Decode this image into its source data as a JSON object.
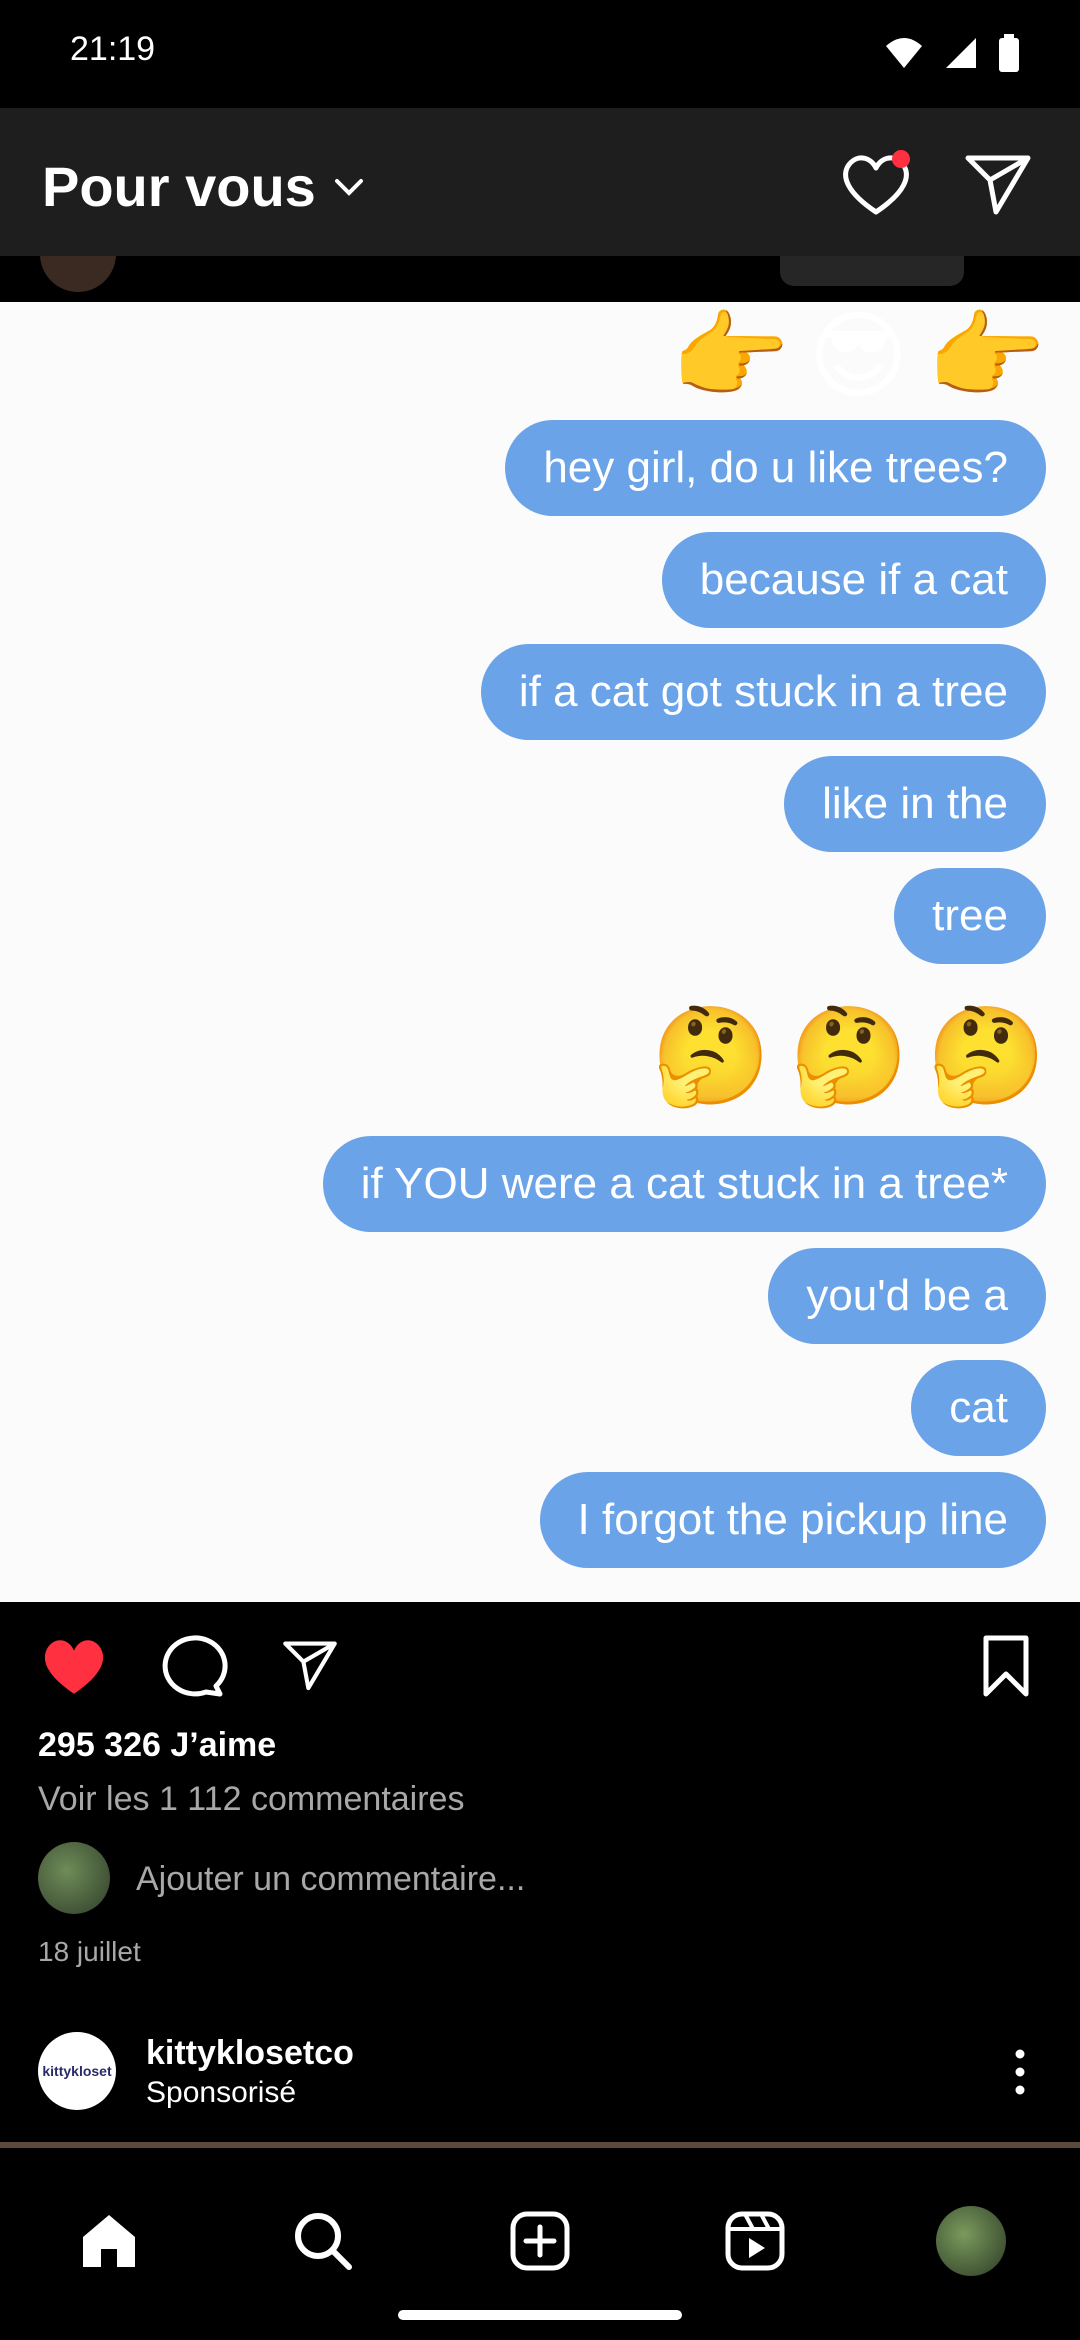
{
  "status_bar": {
    "time": "21:19"
  },
  "header": {
    "title": "Pour vous"
  },
  "post": {
    "image_messages": [
      "hey girl, do u like trees?",
      "because if a cat",
      "if a cat got stuck in a tree",
      "like in the",
      "tree",
      "if YOU were a cat stuck in a tree*",
      "you'd be a",
      "cat",
      "I forgot the pickup line"
    ],
    "emoji_rows": [
      [
        "👉",
        "😎",
        "👉"
      ],
      [
        "🤔",
        "🤔",
        "🤔"
      ]
    ],
    "likes": "295 326 J’aime",
    "view_comments": "Voir les 1 112 commentaires",
    "comment_placeholder": "Ajouter un commentaire...",
    "date": "18 juillet",
    "liked": true
  },
  "sponsored_post": {
    "avatar_text": "kittykloset",
    "username": "kittyklosetco",
    "subtitle": "Sponsorisé"
  },
  "colors": {
    "bubble": "#6aa3e8",
    "like_red": "#ff3040",
    "bar_bg": "#1e1e1e"
  },
  "icons": [
    "heart-icon",
    "send-icon",
    "comment-icon",
    "bookmark-icon",
    "home-icon",
    "search-icon",
    "add-icon",
    "reels-icon"
  ]
}
